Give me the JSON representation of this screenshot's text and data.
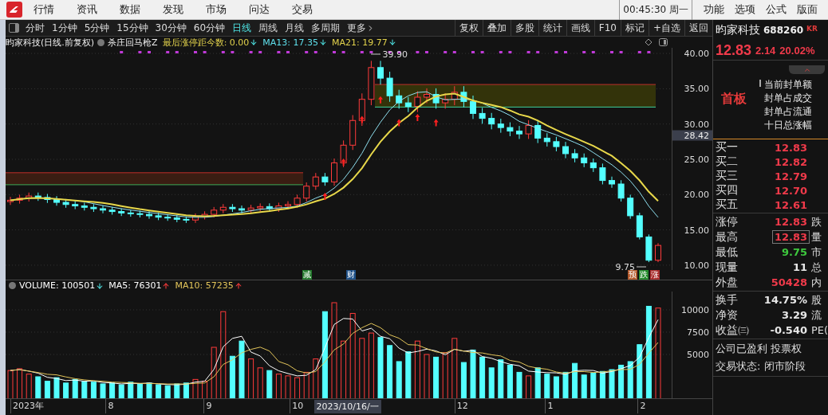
{
  "menu": [
    "行情",
    "资讯",
    "数据",
    "发现",
    "市场",
    "问达",
    "交易"
  ],
  "clock": "00:45:30 周一",
  "menu_right": [
    "功能",
    "选项",
    "公式",
    "版面"
  ],
  "period_tabs": [
    {
      "label": "分时",
      "selected": false
    },
    {
      "label": "1分钟",
      "selected": false
    },
    {
      "label": "5分钟",
      "selected": false
    },
    {
      "label": "15分钟",
      "selected": false
    },
    {
      "label": "30分钟",
      "selected": false
    },
    {
      "label": "60分钟",
      "selected": false
    },
    {
      "label": "日线",
      "selected": true
    },
    {
      "label": "周线",
      "selected": false
    },
    {
      "label": "月线",
      "selected": false
    },
    {
      "label": "多周期",
      "selected": false
    },
    {
      "label": "更多",
      "selected": false
    }
  ],
  "tools": [
    "复权",
    "叠加",
    "多股",
    "统计",
    "画线",
    "F10",
    "标记",
    "+自选",
    "返回"
  ],
  "chart_header": {
    "title": "昀家科技(日线.前复权)",
    "indicator": "杀庄回马枪Z",
    "items": [
      {
        "label": "最后涨停距今数: 0.00",
        "color": "#e2d24c",
        "rising": false
      },
      {
        "label": "MA13: 17.35",
        "color": "#5fe0ec",
        "rising": false
      },
      {
        "label": "MA21: 19.77",
        "color": "#e2d24c",
        "rising": false
      }
    ]
  },
  "price_chart": {
    "axis": [
      "40.00",
      "35.00",
      "30.00",
      "25.00",
      "20.00",
      "15.00",
      "10.00"
    ],
    "crosshair_price": "28.42",
    "high_label": "39.90",
    "low_label": "9.75"
  },
  "markers": [
    {
      "label": "减",
      "color": "#23782c"
    },
    {
      "label": "财",
      "color": "#1d4f86"
    },
    {
      "label": "预",
      "color": "#b4582a"
    },
    {
      "label": "跌",
      "color": "#238a2c"
    },
    {
      "label": "涨",
      "color": "#a82a2a"
    }
  ],
  "volume_header": {
    "items": [
      {
        "label": "VOLUME: 100501",
        "color": "#ffffff",
        "rising": false
      },
      {
        "label": "MA5: 76301",
        "color": "#ffffff",
        "rising": true
      },
      {
        "label": "MA10: 57235",
        "color": "#e2c45a",
        "rising": true
      }
    ]
  },
  "volume_chart": {
    "axis": [
      "10000",
      "7500",
      "5000"
    ]
  },
  "date_axis": {
    "labels": [
      "2023年",
      "8",
      "9",
      "10",
      "12",
      "1",
      "2"
    ],
    "crosshair": "2023/10/16/一"
  },
  "quote": {
    "name": "昀家科技",
    "code": "688260",
    "tag": "KR",
    "price": "12.83",
    "change": "2.14",
    "change_pct": "20.02%"
  },
  "board": {
    "label": "首板",
    "lines": [
      "当前封单额",
      "封单占成交",
      "封单占流通",
      "十日总涨幅"
    ]
  },
  "bids": [
    {
      "label": "买一",
      "price": "12.83"
    },
    {
      "label": "买二",
      "price": "12.82"
    },
    {
      "label": "买三",
      "price": "12.79"
    },
    {
      "label": "买四",
      "price": "12.70"
    },
    {
      "label": "买五",
      "price": "12.61"
    }
  ],
  "stats": [
    {
      "label": "涨停",
      "value": "12.83",
      "color": "#f03a4a",
      "boxed": false,
      "next": "跌"
    },
    {
      "label": "最高",
      "value": "12.83",
      "color": "#f03a4a",
      "boxed": true,
      "next": "量"
    },
    {
      "label": "最低",
      "value": "9.75",
      "color": "#3ec83e",
      "boxed": false,
      "next": "市"
    },
    {
      "label": "现量",
      "value": "11",
      "color": "#e8e8e8",
      "boxed": false,
      "next": "总"
    },
    {
      "label": "外盘",
      "value": "50428",
      "color": "#f03a4a",
      "boxed": false,
      "next": "内"
    }
  ],
  "stats2": [
    {
      "label": "换手",
      "value": "14.75%",
      "next": "股"
    },
    {
      "label": "净资",
      "value": "3.29",
      "next": "流"
    },
    {
      "label": "收益㈢",
      "value": "-0.540",
      "next": "PE("
    }
  ],
  "notes": [
    "公司已盈利 投票权",
    "交易状态: 闭市阶段"
  ]
}
